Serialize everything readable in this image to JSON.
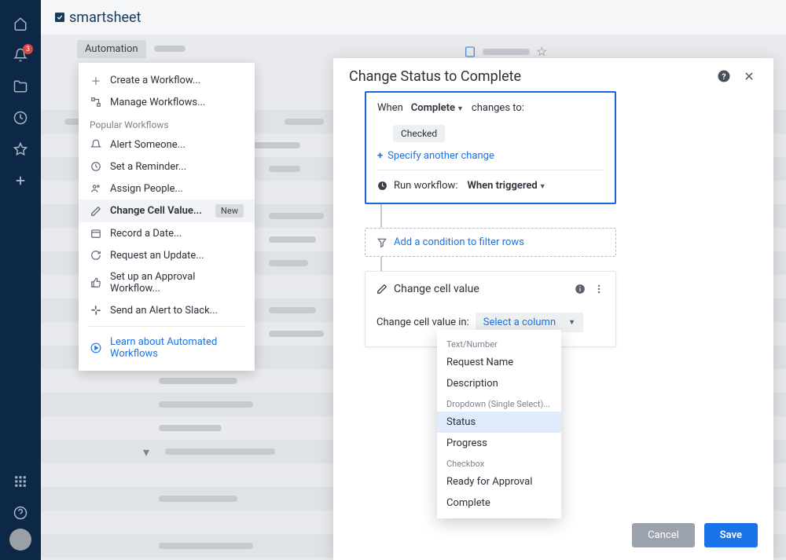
{
  "brand": "smartsheet",
  "rail": {
    "notifications_count": "3"
  },
  "toolbar": {
    "automation_label": "Automation"
  },
  "automation_menu": {
    "create": "Create a Workflow...",
    "manage": "Manage Workflows...",
    "popular_label": "Popular Workflows",
    "items": [
      {
        "icon": "bell-icon",
        "label": "Alert Someone..."
      },
      {
        "icon": "clock-icon",
        "label": "Set a Reminder..."
      },
      {
        "icon": "people-icon",
        "label": "Assign People..."
      },
      {
        "icon": "pencil-icon",
        "label": "Change Cell Value...",
        "badge": "New",
        "highlight": true
      },
      {
        "icon": "calendar-icon",
        "label": "Record a Date..."
      },
      {
        "icon": "refresh-icon",
        "label": "Request an Update..."
      },
      {
        "icon": "thumbs-up-icon",
        "label": "Set up an Approval Workflow..."
      },
      {
        "icon": "slack-icon",
        "label": "Send an Alert to Slack..."
      }
    ],
    "learn": "Learn about Automated Workflows"
  },
  "panel": {
    "title": "Change Status to Complete",
    "trigger": {
      "when_label": "When",
      "column": "Complete",
      "changes_label": "changes to:",
      "value_chip": "Checked",
      "specify_another": "Specify another change",
      "run_label": "Run workflow:",
      "run_value": "When triggered"
    },
    "condition_label": "Add a condition to filter rows",
    "action": {
      "title": "Change cell value",
      "change_label": "Change cell value in:",
      "select_placeholder": "Select a column"
    },
    "column_dropdown": {
      "groups": [
        {
          "label": "Text/Number",
          "options": [
            "Request Name",
            "Description"
          ]
        },
        {
          "label": "Dropdown (Single Select)...",
          "options": [
            "Status",
            "Progress"
          ],
          "active": "Status"
        },
        {
          "label": "Checkbox",
          "options": [
            "Ready for Approval",
            "Complete"
          ]
        }
      ]
    },
    "footer": {
      "cancel": "Cancel",
      "save": "Save"
    }
  }
}
